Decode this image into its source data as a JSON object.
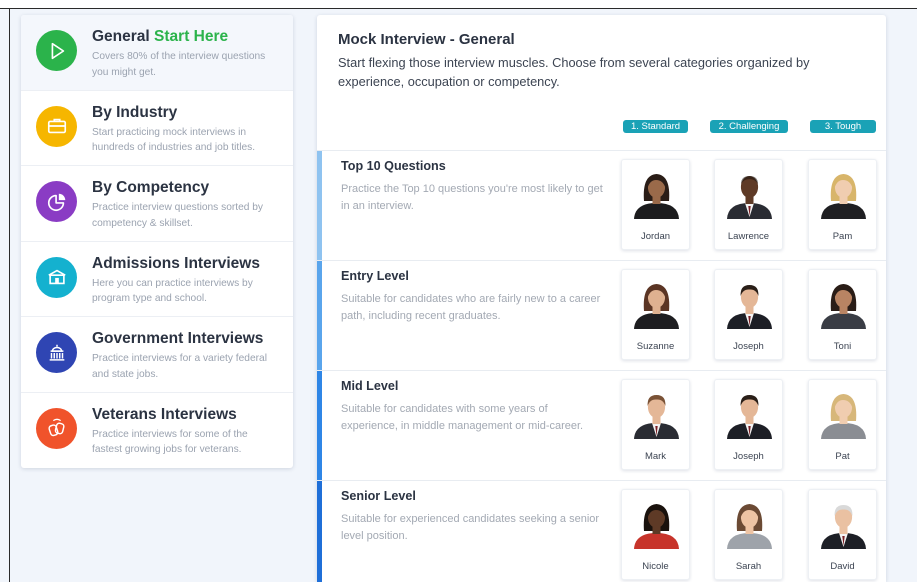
{
  "sidebar": {
    "items": [
      {
        "title": "General",
        "accent": "Start Here",
        "desc": "Covers 80% of the interview questions you might get.",
        "icon": "play-icon",
        "color": "#2bb34b"
      },
      {
        "title": "By Industry",
        "desc": "Start practicing mock interviews in hundreds of industries and job titles.",
        "icon": "briefcase-icon",
        "color": "#f6b600"
      },
      {
        "title": "By Competency",
        "desc": "Practice interview questions sorted by competency & skillset.",
        "icon": "pie-chart-icon",
        "color": "#8a3cc4"
      },
      {
        "title": "Admissions Interviews",
        "desc": "Here you can practice interviews by program type and school.",
        "icon": "school-icon",
        "color": "#14b1cf"
      },
      {
        "title": "Government Interviews",
        "desc": "Practice interviews for a variety federal and state jobs.",
        "icon": "capitol-icon",
        "color": "#2f45b3"
      },
      {
        "title": "Veterans Interviews",
        "desc": "Practice interviews for some of the fastest growing jobs for veterans.",
        "icon": "dog-tags-icon",
        "color": "#f0532b"
      }
    ]
  },
  "main": {
    "title": "Mock Interview - General",
    "subtitle": "Start flexing those interview muscles. Choose from several categories organized by experience, occupation or competency.",
    "difficulties": [
      "1. Standard",
      "2. Challenging",
      "3. Tough"
    ],
    "accent_color": "#1aa2b6",
    "levels": [
      {
        "name": "Top 10 Questions",
        "desc": "Practice the Top 10 questions you're most likely to get in an interview.",
        "bar_color": "#8fc3f0",
        "interviewers": [
          {
            "name": "Jordan",
            "gender": "f",
            "skin": "#9a6a4a",
            "hair": "#2a1d17",
            "shirt": "#1c1c1e",
            "bald": false
          },
          {
            "name": "Lawrence",
            "gender": "m",
            "skin": "#5e3a26",
            "hair": "#1a120d",
            "shirt": "#2a2c33",
            "bald": true
          },
          {
            "name": "Pam",
            "gender": "f",
            "skin": "#f0cdb0",
            "hair": "#d8b56a",
            "shirt": "#1f1f22",
            "bald": false
          }
        ]
      },
      {
        "name": "Entry Level",
        "desc": "Suitable for candidates who are fairly new to a career path, including recent graduates.",
        "bar_color": "#5aa5ec",
        "interviewers": [
          {
            "name": "Suzanne",
            "gender": "f",
            "skin": "#dfb190",
            "hair": "#5b3524",
            "shirt": "#1d1d20",
            "bald": false
          },
          {
            "name": "Joseph",
            "gender": "m",
            "skin": "#e4b797",
            "hair": "#2a1f18",
            "shirt": "#1d1f26",
            "bald": false
          },
          {
            "name": "Toni",
            "gender": "f",
            "skin": "#b98463",
            "hair": "#2a1d17",
            "shirt": "#3a3d45",
            "bald": false
          }
        ]
      },
      {
        "name": "Mid Level",
        "desc": "Suitable for candidates with some years of experience, in middle management or mid-career.",
        "bar_color": "#2f86e6",
        "interviewers": [
          {
            "name": "Mark",
            "gender": "m",
            "skin": "#e4b797",
            "hair": "#7a5236",
            "shirt": "#2a2c33",
            "bald": false
          },
          {
            "name": "Joseph",
            "gender": "m",
            "skin": "#e4b797",
            "hair": "#2a1f18",
            "shirt": "#1d1f26",
            "bald": false
          },
          {
            "name": "Pat",
            "gender": "f",
            "skin": "#f0cdb0",
            "hair": "#d7b77a",
            "shirt": "#8a8d93",
            "bald": false
          }
        ]
      },
      {
        "name": "Senior Level",
        "desc": "Suitable for experienced candidates seeking a senior level position.",
        "bar_color": "#1f6fd8",
        "interviewers": [
          {
            "name": "Nicole",
            "gender": "f",
            "skin": "#5e3a26",
            "hair": "#1a120d",
            "shirt": "#c7342b",
            "bald": false
          },
          {
            "name": "Sarah",
            "gender": "f",
            "skin": "#eec4a4",
            "hair": "#6b4a34",
            "shirt": "#9ea3aa",
            "bald": false
          },
          {
            "name": "David",
            "gender": "m",
            "skin": "#eac1a2",
            "hair": "#d9d9d9",
            "shirt": "#1d1f26",
            "bald": false
          }
        ]
      }
    ]
  }
}
